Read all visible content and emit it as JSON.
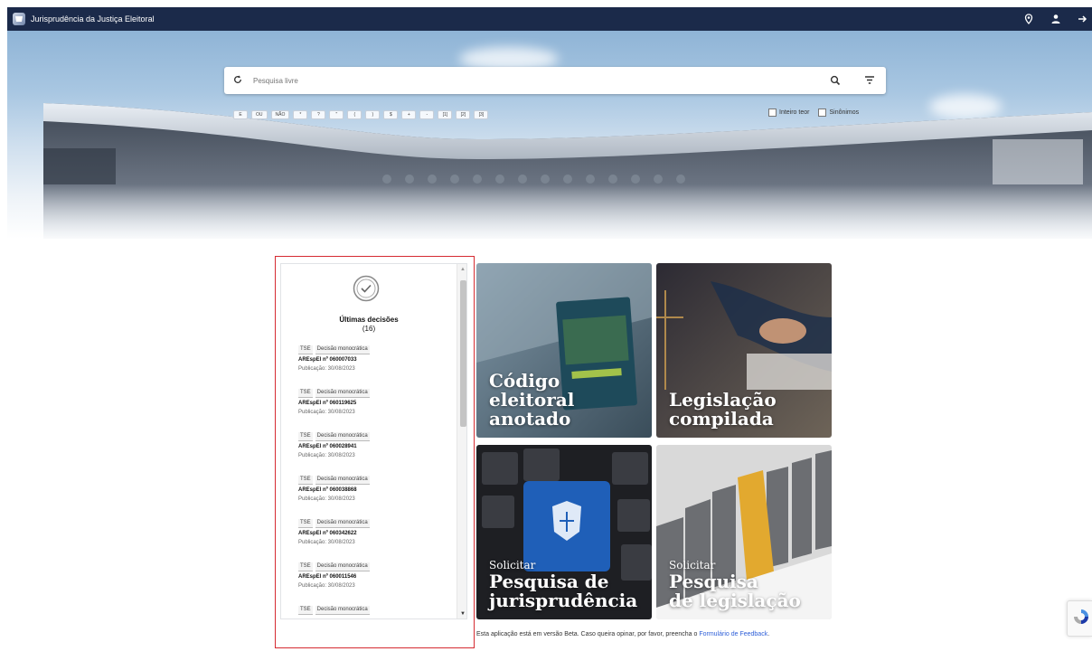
{
  "header": {
    "title": "Jurisprudência da Justiça Eleitoral",
    "icons": [
      "location-pin-icon",
      "user-icon",
      "logout-icon"
    ]
  },
  "search": {
    "placeholder": "Pesquisa livre",
    "operators": [
      "E",
      "OU",
      "NÃO",
      "*",
      "?",
      "\"",
      "(",
      ")",
      "$",
      "+",
      "-",
      "[1]",
      "[2]",
      "[3]"
    ],
    "options": [
      "Inteiro teor",
      "Sinônimos"
    ]
  },
  "recent": {
    "title": "Últimas decisões",
    "count": "(16)",
    "items": [
      {
        "court": "TSE",
        "type": "Decisão monocrática",
        "process": "AREspEl nº 060007033",
        "date": "Publicação: 30/08/2023"
      },
      {
        "court": "TSE",
        "type": "Decisão monocrática",
        "process": "AREspEl nº 060119625",
        "date": "Publicação: 30/08/2023"
      },
      {
        "court": "TSE",
        "type": "Decisão monocrática",
        "process": "AREspEl nº 060028941",
        "date": "Publicação: 30/08/2023"
      },
      {
        "court": "TSE",
        "type": "Decisão monocrática",
        "process": "AREspEl nº 060038868",
        "date": "Publicação: 30/08/2023"
      },
      {
        "court": "TSE",
        "type": "Decisão monocrática",
        "process": "AREspEl nº 060342622",
        "date": "Publicação: 30/08/2023"
      },
      {
        "court": "TSE",
        "type": "Decisão monocrática",
        "process": "AREspEl nº 060011546",
        "date": "Publicação: 30/08/2023"
      },
      {
        "court": "TSE",
        "type": "Decisão monocrática",
        "process": "",
        "date": ""
      }
    ]
  },
  "tiles": {
    "codigo": {
      "line1": "Código",
      "line2": "eleitoral",
      "line3": "anotado"
    },
    "legislacao": {
      "line1": "Legislação",
      "line2": "compilada"
    },
    "pesq_juris": {
      "small": "Solicitar",
      "line1": "Pesquisa de",
      "line2": "jurisprudência"
    },
    "pesq_leg": {
      "small": "Solicitar",
      "line1": "Pesquisa",
      "line2": "de legislação"
    }
  },
  "footer": {
    "text": "Esta aplicação está em versão Beta. Caso queira opinar, por favor, preencha o",
    "link": "Formulário de Feedback",
    "end": "."
  },
  "colors": {
    "topbar": "#1b2a4a",
    "highlight": "#d52b32",
    "link": "#2d5ed8"
  }
}
